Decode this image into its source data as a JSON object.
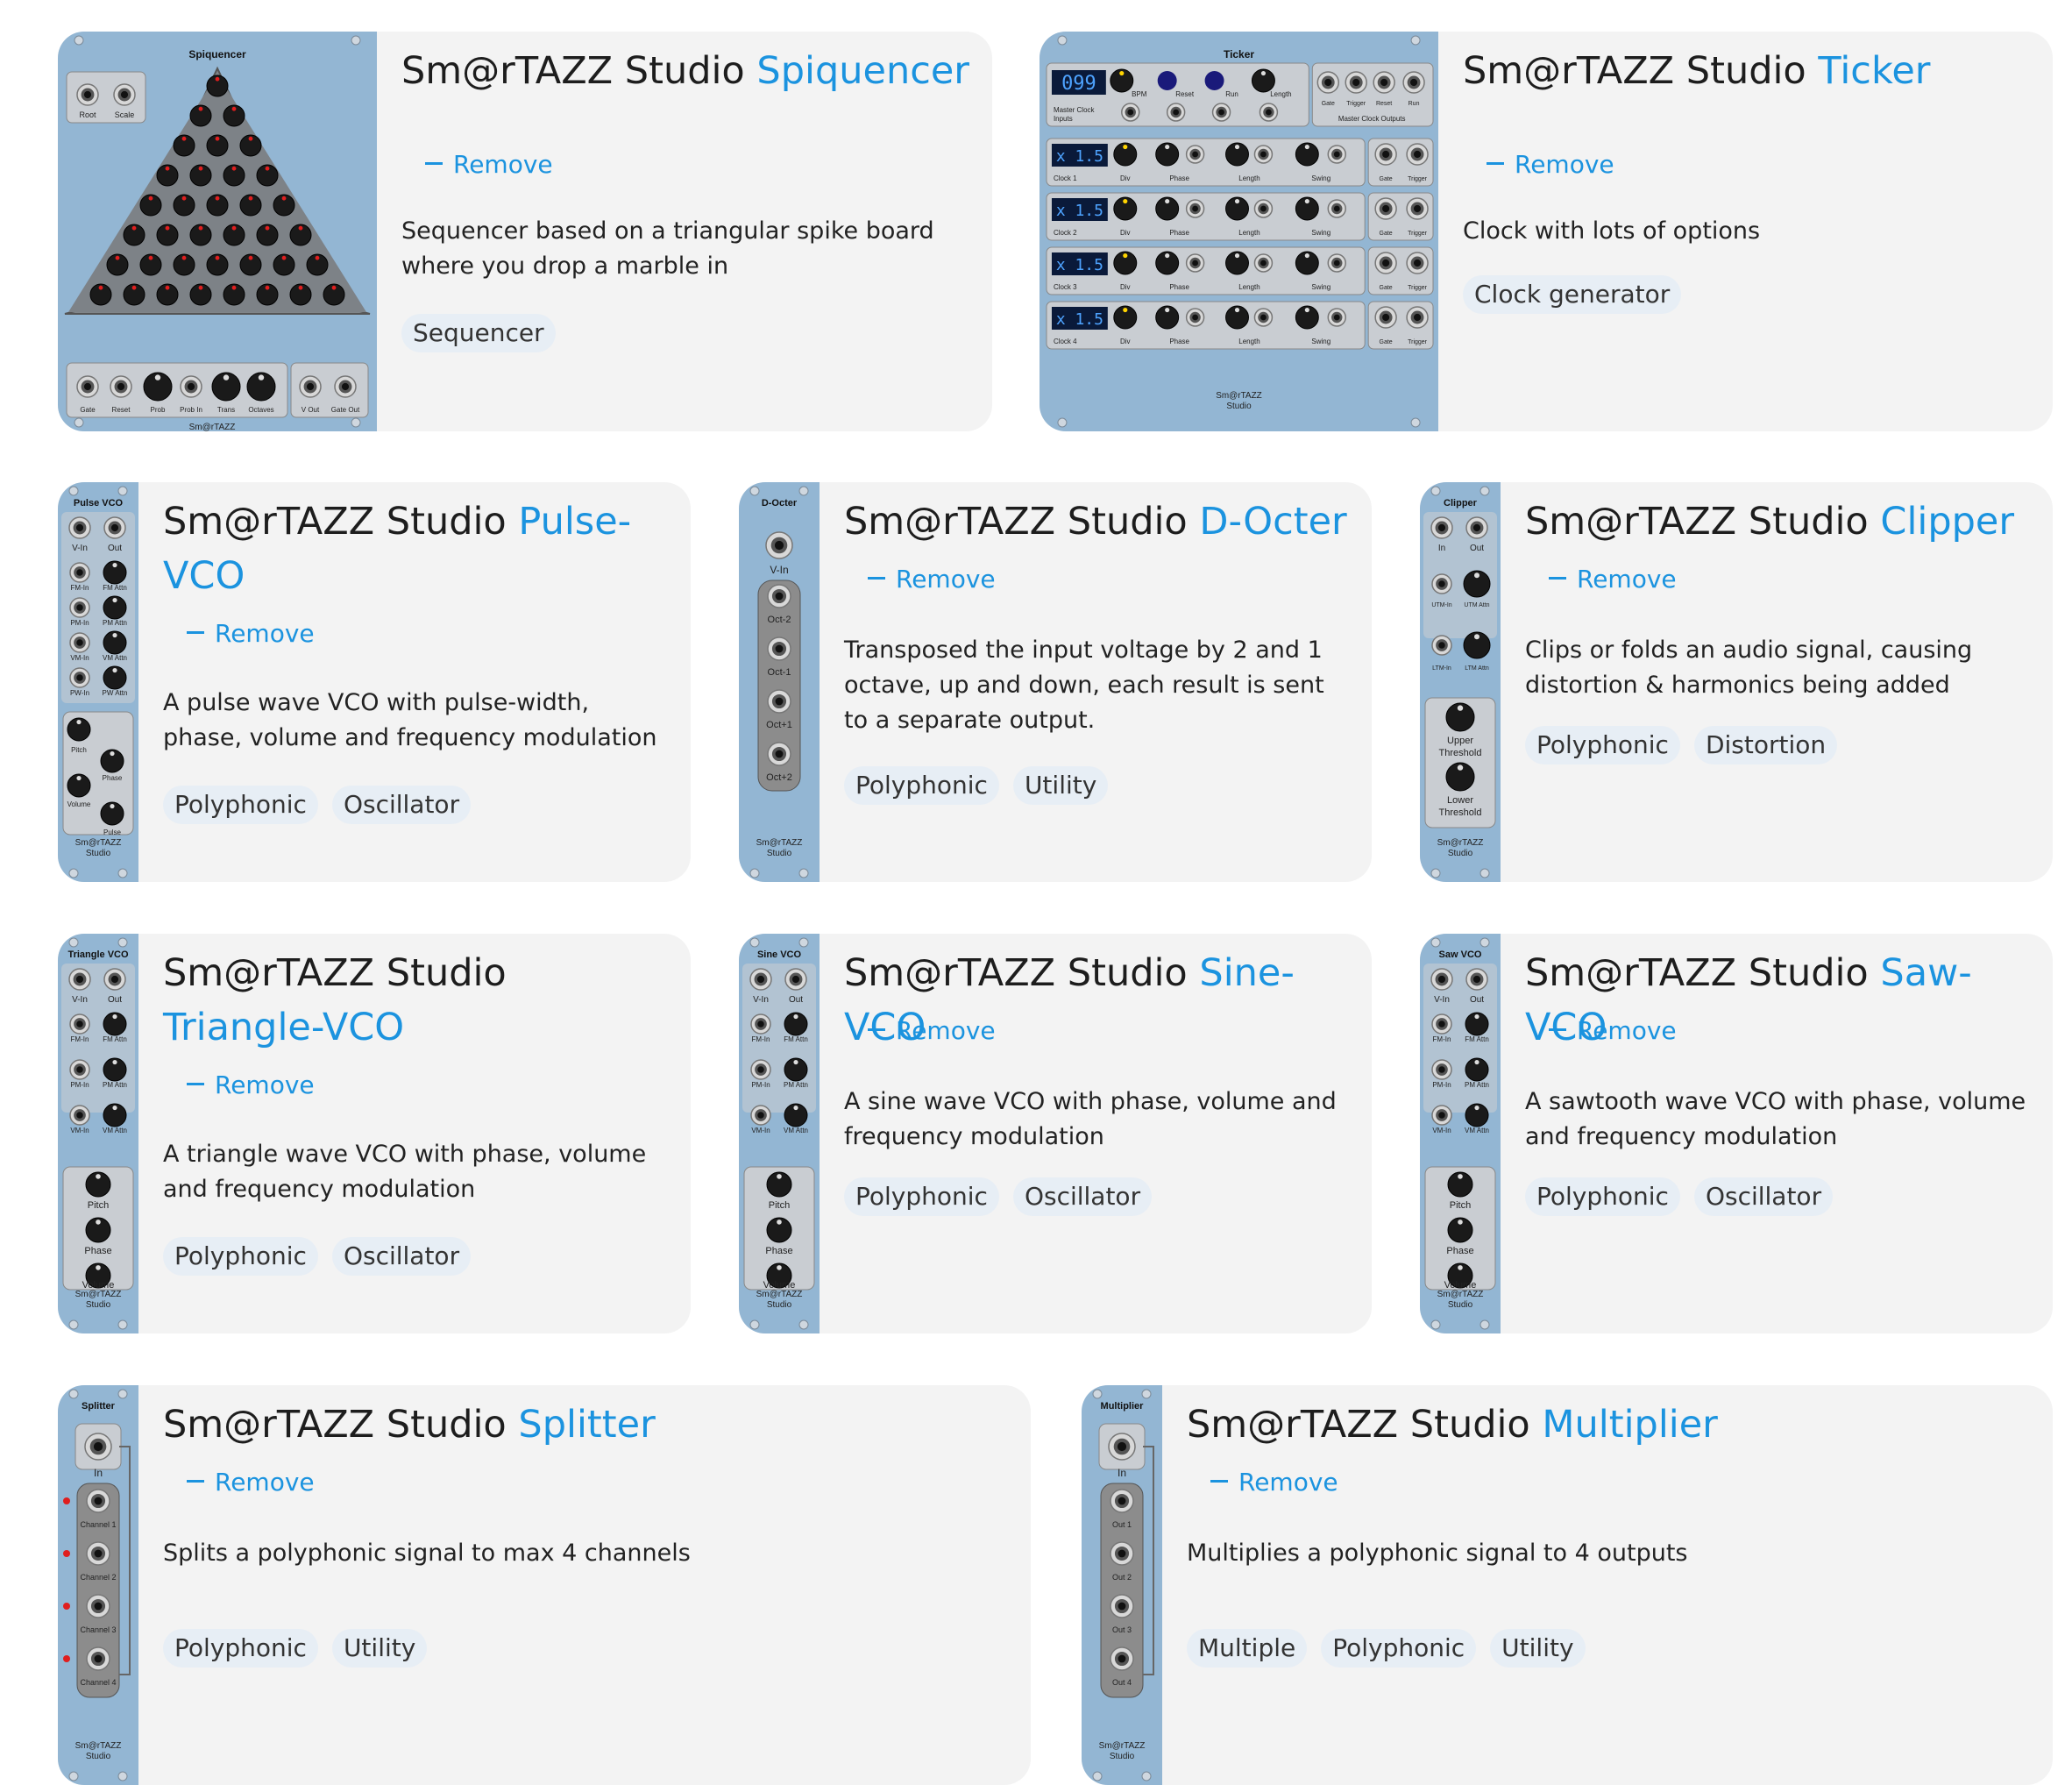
{
  "common": {
    "brand_prefix": "Sm@rTAZZ Studio",
    "remove_label": "Remove"
  },
  "modules": [
    {
      "panel_title": "Spiquencer",
      "name": "Spiquencer",
      "description": "Sequencer based on a triangular spike board where you drop a marble in",
      "tags": [
        "Sequencer"
      ],
      "panel_labels": [
        "Root",
        "Scale",
        "Gate",
        "Reset",
        "Prob",
        "Prob In",
        "Trans",
        "Octaves",
        "V Out",
        "Gate Out"
      ]
    },
    {
      "panel_title": "Ticker",
      "name": "Ticker",
      "description": "Clock with lots of options",
      "tags": [
        "Clock generator"
      ],
      "panel_labels": [
        "099",
        "BPM",
        "Reset",
        "Run",
        "Length",
        "Master Clock Inputs",
        "Gate",
        "Trigger",
        "Reset",
        "Run",
        "Master Clock Outputs",
        "x 1.5",
        "Clock 1",
        "Clock 2",
        "Clock 3",
        "Clock 4",
        "Div",
        "Phase",
        "Length",
        "Swing",
        "Gate",
        "Trigger"
      ]
    },
    {
      "panel_title": "Pulse VCO",
      "name": "Pulse-VCO",
      "description": "A pulse wave VCO with pulse-width, phase, volume and frequency modulation",
      "tags": [
        "Polyphonic",
        "Oscillator"
      ],
      "panel_labels": [
        "V-In",
        "Out",
        "FM-In",
        "FM Attn",
        "PM-In",
        "PM Attn",
        "VM-In",
        "VM Attn",
        "PW-In",
        "PW Attn",
        "Pitch",
        "Phase",
        "Volume",
        "Pulse"
      ]
    },
    {
      "panel_title": "D-Octer",
      "name": "D-Octer",
      "description": "Transposed the input voltage by 2 and 1 octave, up and down, each result is sent to a separate output.",
      "tags": [
        "Polyphonic",
        "Utility"
      ],
      "panel_labels": [
        "V-In",
        "Oct-2",
        "Oct-1",
        "Oct+1",
        "Oct+2"
      ]
    },
    {
      "panel_title": "Clipper",
      "name": "Clipper",
      "description": "Clips or folds an audio signal, causing distortion & harmonics being added",
      "tags": [
        "Polyphonic",
        "Distortion"
      ],
      "panel_labels": [
        "In",
        "Out",
        "UTM-In",
        "UTM Attn",
        "LTM-In",
        "LTM Attn",
        "Upper Threshold",
        "Lower Threshold"
      ]
    },
    {
      "panel_title": "Triangle VCO",
      "name": "Triangle-VCO",
      "description": "A triangle wave VCO with phase, volume and frequency modulation",
      "tags": [
        "Polyphonic",
        "Oscillator"
      ],
      "panel_labels": [
        "V-In",
        "Out",
        "FM-In",
        "FM Attn",
        "PM-In",
        "PM Attn",
        "VM-In",
        "VM Attn",
        "Pitch",
        "Phase",
        "Volume"
      ]
    },
    {
      "panel_title": "Sine VCO",
      "name": "Sine-VCO",
      "description": "A sine wave VCO with phase, volume and frequency modulation",
      "tags": [
        "Polyphonic",
        "Oscillator"
      ],
      "panel_labels": [
        "V-In",
        "Out",
        "FM-In",
        "FM Attn",
        "PM-In",
        "PM Attn",
        "VM-In",
        "VM Attn",
        "Pitch",
        "Phase",
        "Volume"
      ]
    },
    {
      "panel_title": "Saw VCO",
      "name": "Saw-VCO",
      "description": "A sawtooth wave VCO with phase, volume and frequency modulation",
      "tags": [
        "Polyphonic",
        "Oscillator"
      ],
      "panel_labels": [
        "V-In",
        "Out",
        "FM-In",
        "FM Attn",
        "PM-In",
        "PM Attn",
        "VM-In",
        "VM Attn",
        "Pitch",
        "Phase",
        "Volume"
      ]
    },
    {
      "panel_title": "Splitter",
      "name": "Splitter",
      "description": "Splits a polyphonic signal to max 4 channels",
      "tags": [
        "Polyphonic",
        "Utility"
      ],
      "panel_labels": [
        "In",
        "Channel 1",
        "Channel 2",
        "Channel 3",
        "Channel 4"
      ]
    },
    {
      "panel_title": "Multiplier",
      "name": "Multiplier",
      "description": "Multiplies a polyphonic signal to 4 outputs",
      "tags": [
        "Multiple",
        "Polyphonic",
        "Utility"
      ],
      "panel_labels": [
        "In",
        "Out 1",
        "Out 2",
        "Out 3",
        "Out 4"
      ]
    }
  ],
  "panel_footer": [
    "Sm@rTAZZ",
    "Studio"
  ],
  "colors": {
    "accent": "#1b93df",
    "panel": "#93b6d3",
    "card": "#f3f3f3",
    "tag": "#e7eef5",
    "knob_tip": "#e01e1e"
  }
}
